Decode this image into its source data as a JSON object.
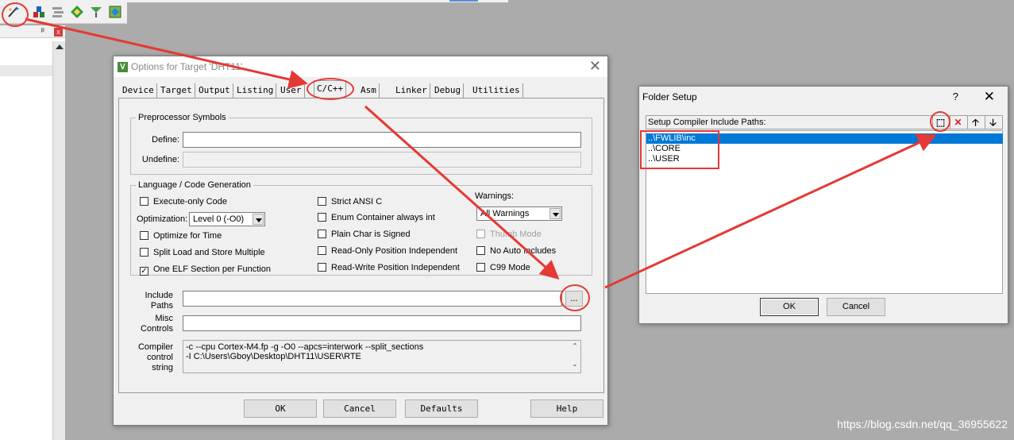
{
  "toolbar": {
    "icons": [
      "options-wand-icon",
      "load-icon",
      "batch-build-icon",
      "download-icon",
      "manage-icon",
      "pack-icon"
    ]
  },
  "left_panel": {
    "pin": "ᵖ",
    "close": "x"
  },
  "options_dialog": {
    "title": "Options for Target 'DHT11'",
    "close": "✕",
    "tabs": [
      "Device",
      "Target",
      "Output",
      "Listing",
      "User",
      "C/C++",
      "Asm",
      "Linker",
      "Debug",
      "Utilities"
    ],
    "active_tab": "C/C++",
    "preprocessor": {
      "legend": "Preprocessor Symbols",
      "define_label": "Define:",
      "define_value": "",
      "undefine_label": "Undefine:",
      "undefine_value": ""
    },
    "language": {
      "legend": "Language / Code Generation",
      "execute_only": {
        "label": "Execute-only Code",
        "checked": false
      },
      "optimization_label": "Optimization:",
      "optimization_value": "Level 0 (-O0)",
      "optimize_time": {
        "label": "Optimize for Time",
        "checked": false
      },
      "split_load": {
        "label": "Split Load and Store Multiple",
        "checked": false
      },
      "one_elf": {
        "label": "One ELF Section per Function",
        "checked": true
      },
      "strict_ansi": {
        "label": "Strict ANSI C",
        "checked": false
      },
      "enum_container": {
        "label": "Enum Container always int",
        "checked": false
      },
      "plain_char": {
        "label": "Plain Char is Signed",
        "checked": false
      },
      "ro_pos": {
        "label": "Read-Only Position Independent",
        "checked": false
      },
      "rw_pos": {
        "label": "Read-Write Position Independent",
        "checked": false
      },
      "warnings_label": "Warnings:",
      "warnings_value": "All Warnings",
      "thumb_mode": {
        "label": "Thumb Mode",
        "checked": false
      },
      "no_auto_includes": {
        "label": "No Auto Includes",
        "checked": false
      },
      "c99_mode": {
        "label": "C99 Mode",
        "checked": false
      }
    },
    "include_paths_label_1": "Include",
    "include_paths_label_2": "Paths",
    "include_paths_value": "",
    "browse_button": "...",
    "misc_label_1": "Misc",
    "misc_label_2": "Controls",
    "misc_value": "",
    "compiler_label_1": "Compiler",
    "compiler_label_2": "control",
    "compiler_label_3": "string",
    "compiler_line_1": "-c --cpu Cortex-M4.fp -g -O0 --apcs=interwork --split_sections",
    "compiler_line_2": "-I C:\\Users\\Gboy\\Desktop\\DHT11\\USER\\RTE",
    "scroll_up": "⌃",
    "scroll_down": "⌄",
    "buttons": {
      "ok": "OK",
      "cancel": "Cancel",
      "defaults": "Defaults",
      "help": "Help"
    }
  },
  "folder_dialog": {
    "title": "Folder Setup",
    "help": "?",
    "close": "✕",
    "header": "Setup Compiler Include Paths:",
    "tool_buttons": {
      "new": "⬚",
      "delete": "✕",
      "up": "🡡",
      "down": "🡣"
    },
    "paths": [
      "..\\FWLIB\\inc",
      "..\\CORE",
      "..\\USER"
    ],
    "selected_index": 0,
    "buttons": {
      "ok": "OK",
      "cancel": "Cancel"
    }
  },
  "watermark": "https://blog.csdn.net/qq_36955622",
  "colors": {
    "annotation": "#e53935",
    "selection": "#0078d7",
    "workspace": "#ababab"
  }
}
